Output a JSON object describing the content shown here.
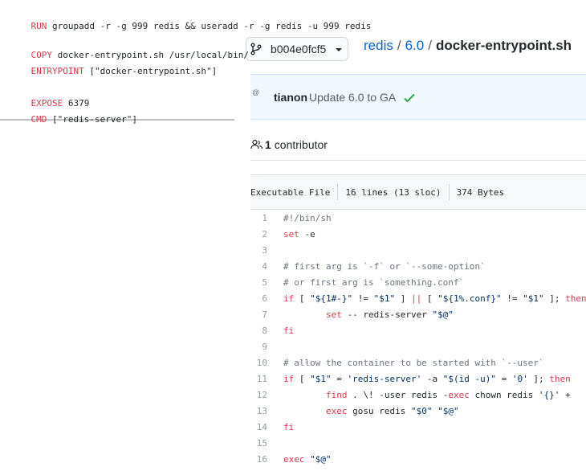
{
  "dockerfile": {
    "lines": [
      {
        "instruction": "RUN",
        "args": " groupadd -r -g 999 redis && useradd -r -g redis -u 999 redis"
      },
      {
        "instruction": "COPY",
        "args": " docker-entrypoint.sh /usr/local/bin/"
      },
      {
        "instruction": "ENTRYPOINT",
        "args": " [\"docker-entrypoint.sh\"]"
      },
      {
        "instruction": "EXPOSE",
        "args": " 6379"
      },
      {
        "instruction": "CMD",
        "args": " [\"redis-server\"]"
      }
    ]
  },
  "branch": {
    "name": "b004e0fcf5",
    "icon": "git-branch-icon"
  },
  "breadcrumb": {
    "repo": "redis",
    "sep1": "/",
    "folder": "6.0",
    "sep2": "/",
    "file": "docker-entrypoint.sh"
  },
  "commit": {
    "avatar_alt": "@",
    "author": "tianon",
    "message": "Update 6.0 to GA",
    "status_icon": "check-icon",
    "status_color": "#28a745"
  },
  "contributors": {
    "count": "1",
    "label": "contributor",
    "icon": "people-icon"
  },
  "file_info": {
    "mode": "Executable File",
    "lines": "16 lines (13 sloc)",
    "size": "374 Bytes"
  },
  "colors": {
    "link": "#0366d6",
    "keyword": "#d73a49",
    "string": "#032f62",
    "comment": "#6a737d",
    "line_number": "#959da5"
  },
  "code": [
    {
      "n": "1",
      "text": "#!/bin/sh"
    },
    {
      "n": "2",
      "text": "set -e"
    },
    {
      "n": "3",
      "text": ""
    },
    {
      "n": "4",
      "text": "# first arg is `-f` or `--some-option`"
    },
    {
      "n": "5",
      "text": "# or first arg is `something.conf`"
    },
    {
      "n": "6",
      "text": "if [ \"${1#-}\" != \"$1\" ] || [ \"${1%.conf}\" != \"$1\" ]; then"
    },
    {
      "n": "7",
      "text": "        set -- redis-server \"$@\""
    },
    {
      "n": "8",
      "text": "fi"
    },
    {
      "n": "9",
      "text": ""
    },
    {
      "n": "10",
      "text": "# allow the container to be started with `--user`"
    },
    {
      "n": "11",
      "text": "if [ \"$1\" = 'redis-server' -a \"$(id -u)\" = '0' ]; then"
    },
    {
      "n": "12",
      "text": "        find . \\! -user redis -exec chown redis '{}' +"
    },
    {
      "n": "13",
      "text": "        exec gosu redis \"$0\" \"$@\""
    },
    {
      "n": "14",
      "text": "fi"
    },
    {
      "n": "15",
      "text": ""
    },
    {
      "n": "16",
      "text": "exec \"$@\""
    }
  ]
}
